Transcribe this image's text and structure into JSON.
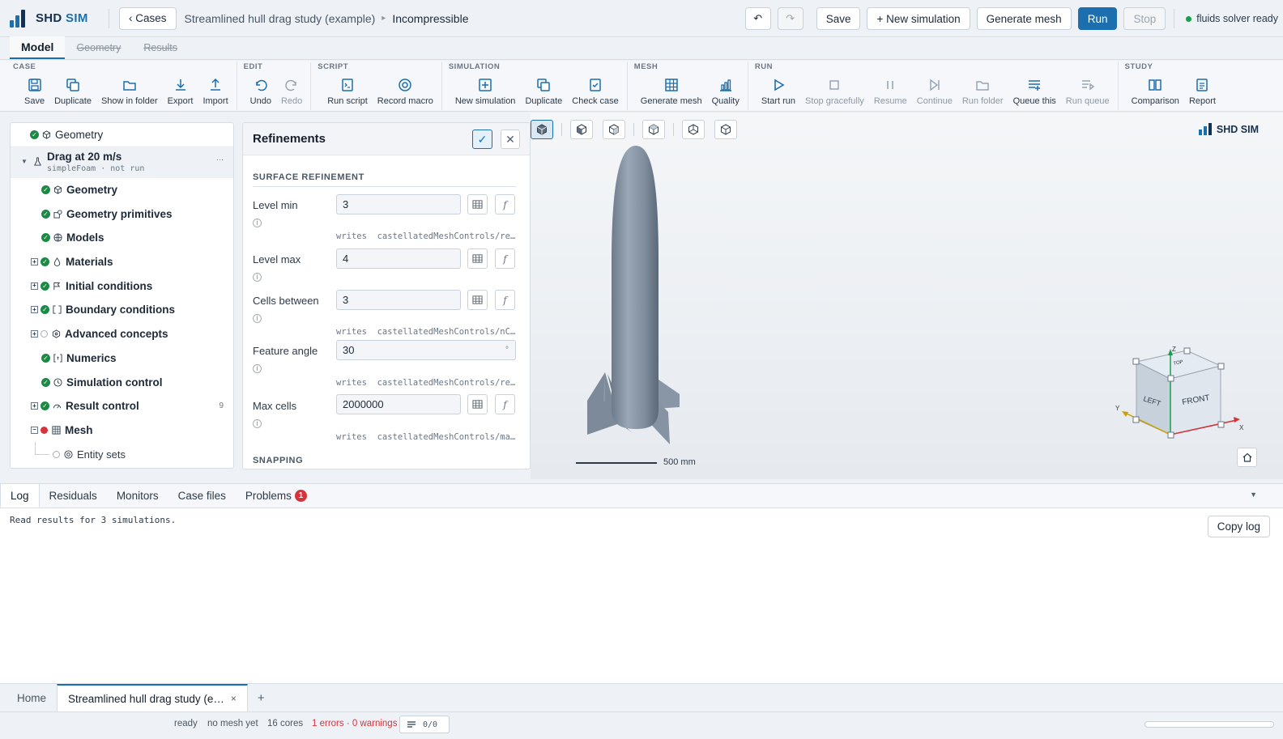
{
  "app": {
    "logo_prefix": "SHD",
    "logo_suffix": "SIM"
  },
  "header": {
    "cases_button": "‹ Cases",
    "breadcrumb_case": "Streamlined hull drag study (example)",
    "breadcrumb_current": "Incompressible",
    "undo_glyph": "↶",
    "redo_glyph": "↷",
    "save": "Save",
    "new_simulation": "+ New simulation",
    "generate_mesh": "Generate mesh",
    "run": "Run",
    "stop": "Stop",
    "solver_status": "fluids solver ready",
    "colors": {
      "accent": "#1b6fae",
      "ok": "#1a9e4b",
      "error": "#d6333b"
    }
  },
  "model_tabs": [
    "Model",
    "Geometry",
    "Results"
  ],
  "ribbon": {
    "case": {
      "title": "CASE",
      "items": [
        "Save",
        "Duplicate",
        "Show in folder",
        "Export",
        "Import"
      ]
    },
    "edit": {
      "title": "EDIT",
      "items": [
        "Undo",
        "Redo"
      ]
    },
    "script": {
      "title": "SCRIPT",
      "items": [
        "Run script",
        "Record macro"
      ]
    },
    "simulation": {
      "title": "SIMULATION",
      "items": [
        "New simulation",
        "Duplicate",
        "Check case"
      ]
    },
    "mesh": {
      "title": "MESH",
      "items": [
        "Generate mesh",
        "Quality"
      ]
    },
    "run": {
      "title": "RUN",
      "items": [
        "Start run",
        "Stop gracefully",
        "Resume",
        "Continue",
        "Run folder",
        "Queue this",
        "Run queue"
      ]
    },
    "study": {
      "title": "STUDY",
      "items": [
        "Comparison",
        "Report"
      ]
    }
  },
  "tree": {
    "geometry_root": "Geometry",
    "simulation_name": "Drag at 20 m/s",
    "simulation_meta": "simpleFoam · not run",
    "simulation_menu": "···",
    "items": [
      {
        "label": "Geometry",
        "icon": "cube-icon"
      },
      {
        "label": "Geometry primitives",
        "icon": "primitives-icon"
      },
      {
        "label": "Models",
        "icon": "globe-icon"
      },
      {
        "label": "Materials",
        "icon": "drop-icon"
      },
      {
        "label": "Initial conditions",
        "icon": "flag-icon"
      },
      {
        "label": "Boundary conditions",
        "icon": "bracket-icon"
      },
      {
        "label": "Advanced concepts",
        "icon": "hex-icon"
      },
      {
        "label": "Numerics",
        "icon": "numerics-icon"
      },
      {
        "label": "Simulation control",
        "icon": "clock-icon"
      },
      {
        "label": "Result control",
        "icon": "gauge-icon",
        "count": "9"
      },
      {
        "label": "Mesh",
        "icon": "grid-icon"
      },
      {
        "label": "Entity sets",
        "icon": "target-icon"
      }
    ]
  },
  "refinements": {
    "title": "Refinements",
    "ok_glyph": "✓",
    "close_glyph": "✕",
    "surface_section": "SURFACE REFINEMENT",
    "snapping_section": "SNAPPING",
    "writes_label": "writes",
    "info_glyph": "i",
    "fx_glyph": "f",
    "fields": [
      {
        "label": "Level min",
        "value": "3",
        "writes": "castellatedMeshControls/refi…"
      },
      {
        "label": "Level max",
        "value": "4"
      },
      {
        "label": "Cells between",
        "value": "3",
        "writes": "castellatedMeshControls/nCel…"
      },
      {
        "label": "Feature angle",
        "value": "30",
        "unit": "°",
        "writes": "castellatedMeshControls/reso…"
      },
      {
        "label": "Max cells",
        "value": "2000000",
        "writes": "castellatedMeshControls/maxG…"
      }
    ]
  },
  "viewport": {
    "logo": "SHD SIM",
    "scale_label": "500 mm",
    "cube_labels": {
      "left": "LEFT",
      "front": "FRONT",
      "top": "TOP"
    },
    "axes": {
      "x": "X",
      "y": "Y",
      "z": "Z"
    }
  },
  "bottom_panel": {
    "tabs": [
      "Log",
      "Residuals",
      "Monitors",
      "Case files",
      "Problems"
    ],
    "problems_count": "1",
    "log_line": "Read results for 3 simulations.",
    "copy_log": "Copy log",
    "collapse_glyph": "▼"
  },
  "doc_tabs": {
    "home": "Home",
    "case": "Streamlined hull drag study (e…",
    "close_glyph": "×",
    "add_glyph": "+"
  },
  "status_bar": {
    "state": "ready",
    "mesh": "no mesh yet",
    "cores": "16 cores",
    "problems": "1 errors · 0 warnings",
    "queue": "0/0"
  }
}
